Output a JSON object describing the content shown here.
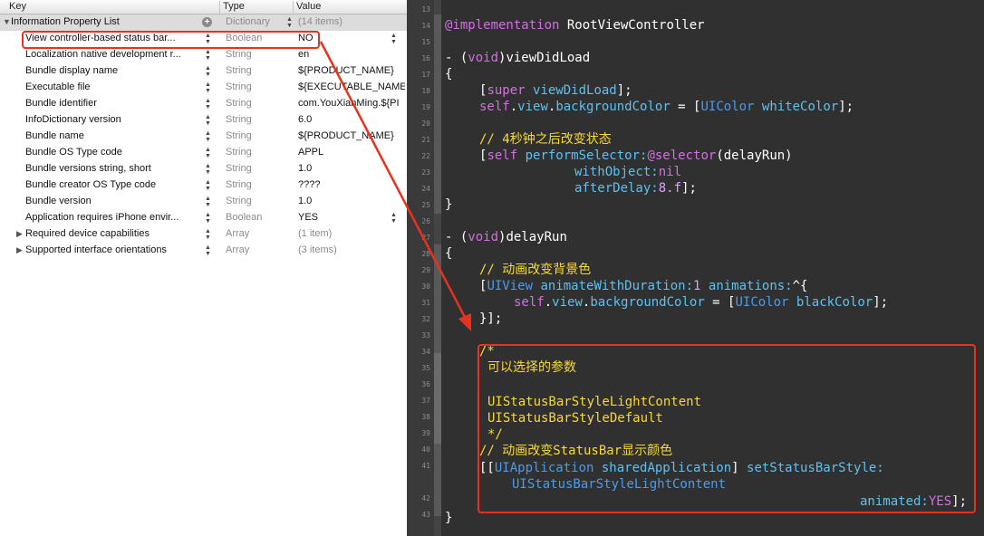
{
  "plist": {
    "columns": {
      "key": "Key",
      "type": "Type",
      "value": "Value"
    },
    "root": {
      "key": "Information Property List",
      "type": "Dictionary",
      "value": "(14 items)"
    },
    "rows": [
      {
        "key": "View controller-based status bar...",
        "type": "Boolean",
        "value": "NO"
      },
      {
        "key": "Localization native development r...",
        "type": "String",
        "value": "en"
      },
      {
        "key": "Bundle display name",
        "type": "String",
        "value": "${PRODUCT_NAME}"
      },
      {
        "key": "Executable file",
        "type": "String",
        "value": "${EXECUTABLE_NAME}"
      },
      {
        "key": "Bundle identifier",
        "type": "String",
        "value": "com.YouXianMing.${PI"
      },
      {
        "key": "InfoDictionary version",
        "type": "String",
        "value": "6.0"
      },
      {
        "key": "Bundle name",
        "type": "String",
        "value": "${PRODUCT_NAME}"
      },
      {
        "key": "Bundle OS Type code",
        "type": "String",
        "value": "APPL"
      },
      {
        "key": "Bundle versions string, short",
        "type": "String",
        "value": "1.0"
      },
      {
        "key": "Bundle creator OS Type code",
        "type": "String",
        "value": "????"
      },
      {
        "key": "Bundle version",
        "type": "String",
        "value": "1.0"
      },
      {
        "key": "Application requires iPhone envir...",
        "type": "Boolean",
        "value": "YES"
      },
      {
        "key": "Required device capabilities",
        "type": "Array",
        "value": "(1 item)"
      },
      {
        "key": "Supported interface orientations",
        "type": "Array",
        "value": "(3 items)"
      }
    ]
  },
  "editor": {
    "line_numbers": [
      "13",
      "14",
      "15",
      "16",
      "17",
      "18",
      "19",
      "20",
      "21",
      "22",
      "23",
      "24",
      "25",
      "26",
      "27",
      "28",
      "29",
      "30",
      "31",
      "32",
      "33",
      "34",
      "35",
      "36",
      "37",
      "38",
      "39",
      "40",
      "41",
      "42",
      "43"
    ],
    "code": {
      "impl_kw": "@implementation",
      "impl_name": " RootViewController",
      "l16_a": "- (",
      "l16_void": "void",
      "l16_b": ")viewDidLoad",
      "l17": "{",
      "l18_a": "[",
      "l18_super": "super",
      "l18_sel": " viewDidLoad",
      "l18_b": "];",
      "l19_self": "self",
      "l19_dot1": ".",
      "l19_view": "view",
      "l19_dot2": ".",
      "l19_bg": "backgroundColor",
      "l19_eq": " = [",
      "l19_cls": "UIColor",
      "l19_white": " whiteColor",
      "l19_end": "];",
      "l21_cm": "// 4秒钟之后改变状态",
      "l22_a": "[",
      "l22_self": "self",
      "l22_sel": " performSelector:",
      "l22_at": "@selector",
      "l22_b": "(delayRun)",
      "l23_sel": "withObject:",
      "l23_nil": "nil",
      "l24_sel": "afterDelay:",
      "l24_num": "8.f",
      "l24_b": "];",
      "l25": "}",
      "l27_a": "- (",
      "l27_void": "void",
      "l27_b": ")delayRun",
      "l28": "{",
      "l29_cm": "// 动画改变背景色",
      "l30_a": "[",
      "l30_cls": "UIView",
      "l30_sel": " animateWithDuration:",
      "l30_num": "1",
      "l30_sel2": " animations:",
      "l30_b": "^{",
      "l31_self": "self",
      "l31_dot1": ".",
      "l31_view": "view",
      "l31_dot2": ".",
      "l31_bg": "backgroundColor",
      "l31_eq": " = [",
      "l31_cls": "UIColor",
      "l31_black": " blackColor",
      "l31_end": "];",
      "l32": "}];",
      "l34_cm": "/*",
      "l35_cm": "可以选择的参数",
      "l37_cm": "UIStatusBarStyleLightContent",
      "l38_cm": "UIStatusBarStyleDefault",
      "l39_cm": "*/",
      "l40_cm": "// 动画改变StatusBar显示颜色",
      "l41_a": "[[",
      "l41_cls": "UIApplication",
      "l41_sel": " sharedApplication",
      "l41_b": "] ",
      "l41_sel2": "setStatusBarStyle:",
      "l41b_cls": "UIStatusBarStyleLightContent",
      "l42_sel": "animated:",
      "l42_yes": "YES",
      "l42_b": "];",
      "l43": "}"
    }
  },
  "colors": {
    "highlight": "#e8321e",
    "editor_bg": "#303030",
    "comment": "#f8da2e",
    "keyword": "#d36fe0",
    "selector": "#5dc1f1",
    "class": "#4c9bea"
  }
}
